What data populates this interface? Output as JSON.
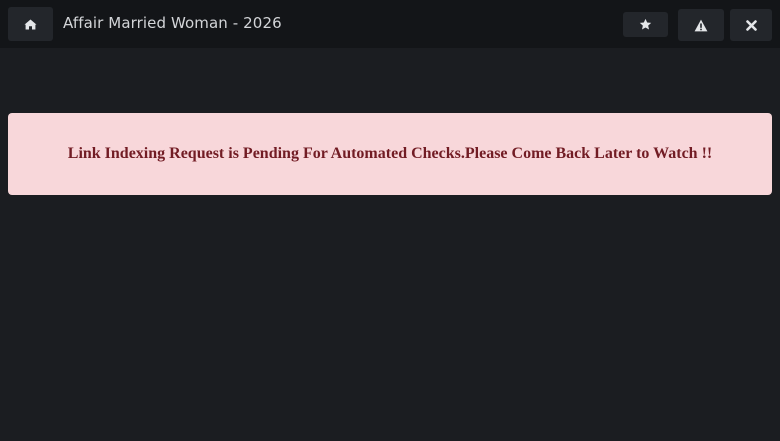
{
  "header": {
    "title": "Affair Married Woman - 2026",
    "buttons": {
      "home": "home-icon",
      "favorite": "star-icon",
      "report": "warning-icon",
      "close": "close-icon"
    }
  },
  "alert": {
    "message": "Link Indexing Request is Pending For Automated Checks.Please Come Back Later to Watch !!"
  },
  "colors": {
    "background": "#1b1d21",
    "topbar": "#131518",
    "button": "#23262b",
    "alert_bg": "#f8d7da",
    "alert_text": "#721c24"
  }
}
